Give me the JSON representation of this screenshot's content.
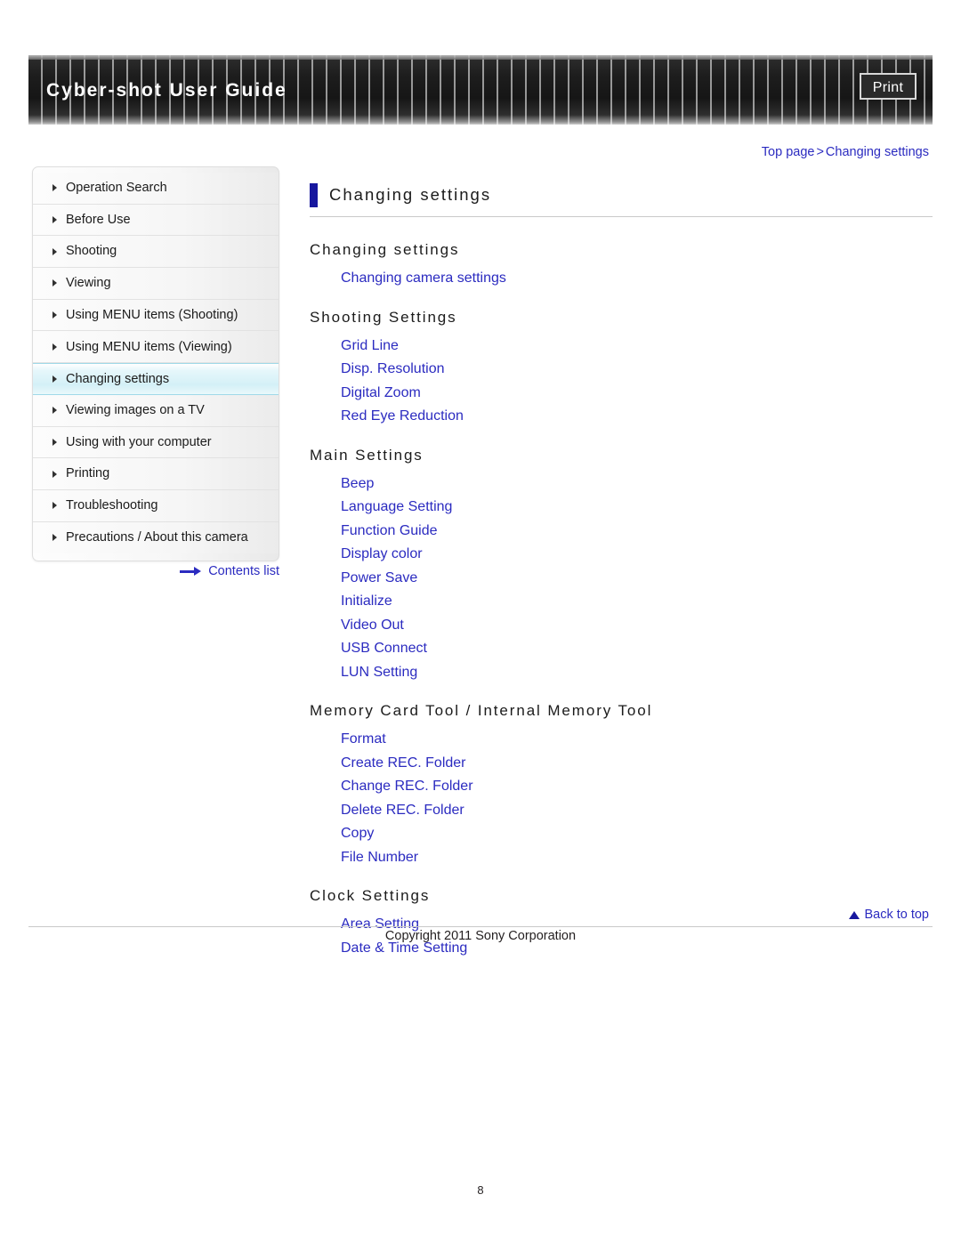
{
  "header": {
    "title": "Cyber-shot User Guide",
    "print_label": "Print"
  },
  "breadcrumb": {
    "top_page": "Top page",
    "separator": ">",
    "current": "Changing settings"
  },
  "sidebar": {
    "items": [
      {
        "label": "Operation Search",
        "active": false
      },
      {
        "label": "Before Use",
        "active": false
      },
      {
        "label": "Shooting",
        "active": false
      },
      {
        "label": "Viewing",
        "active": false
      },
      {
        "label": "Using MENU items (Shooting)",
        "active": false
      },
      {
        "label": "Using MENU items (Viewing)",
        "active": false
      },
      {
        "label": "Changing settings",
        "active": true
      },
      {
        "label": "Viewing images on a TV",
        "active": false
      },
      {
        "label": "Using with your computer",
        "active": false
      },
      {
        "label": "Printing",
        "active": false
      },
      {
        "label": "Troubleshooting",
        "active": false
      },
      {
        "label": "Precautions / About this camera",
        "active": false
      }
    ],
    "contents_list_label": "Contents list"
  },
  "main": {
    "page_title": "Changing settings",
    "sections": [
      {
        "heading": "Changing settings",
        "links": [
          "Changing camera settings"
        ]
      },
      {
        "heading": "Shooting Settings",
        "links": [
          "Grid Line",
          "Disp. Resolution",
          "Digital Zoom",
          "Red Eye Reduction"
        ]
      },
      {
        "heading": "Main Settings",
        "links": [
          "Beep",
          "Language Setting",
          "Function Guide",
          "Display color",
          "Power Save",
          "Initialize",
          "Video Out",
          "USB Connect",
          "LUN Setting"
        ]
      },
      {
        "heading": "Memory Card Tool / Internal Memory Tool",
        "links": [
          "Format",
          "Create REC. Folder",
          "Change REC. Folder",
          "Delete REC. Folder",
          "Copy",
          "File Number"
        ]
      },
      {
        "heading": "Clock Settings",
        "links": [
          "Area Setting",
          "Date & Time Setting"
        ]
      }
    ]
  },
  "footer": {
    "back_to_top": "Back to top",
    "copyright": "Copyright 2011 Sony Corporation",
    "page_number": "8"
  },
  "colors": {
    "link": "#2b2bc0",
    "title_accent": "#17179e",
    "active_nav": "#d4f0f7"
  }
}
